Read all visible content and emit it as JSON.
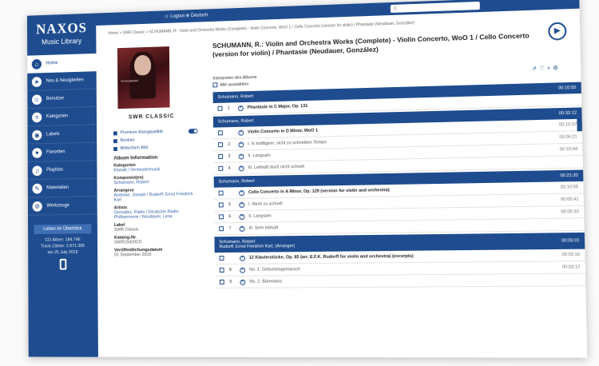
{
  "app": {
    "logo_title": "NAXOS",
    "logo_subtitle": "Music Library"
  },
  "topbar": {
    "links": "☺ Logout  ⊕ Deutsch",
    "search_placeholder": "Q"
  },
  "sidebar": {
    "items": [
      {
        "label": "Home",
        "icon": "home-icon",
        "glyph": "⌂",
        "active": true
      },
      {
        "label": "Neu & Neuigkeiten",
        "icon": "new-icon",
        "glyph": "★",
        "active": false
      },
      {
        "label": "Benutzer",
        "icon": "user-icon",
        "glyph": "☺",
        "active": false
      },
      {
        "label": "Kategorien",
        "icon": "categories-icon",
        "glyph": "≡",
        "active": false
      },
      {
        "label": "Labels",
        "icon": "labels-icon",
        "glyph": "◉",
        "active": false
      },
      {
        "label": "Favoriten",
        "icon": "favorites-icon",
        "glyph": "♥",
        "active": false
      },
      {
        "label": "Playlists",
        "icon": "playlist-icon",
        "glyph": "♫",
        "active": false
      },
      {
        "label": "Materialien",
        "icon": "materials-icon",
        "glyph": "✎",
        "active": false
      },
      {
        "label": "Werkzeuge",
        "icon": "tools-icon",
        "glyph": "⚙",
        "active": false
      }
    ],
    "button": "Leben im Überblick",
    "info_lines": [
      "CD-Alben: 184.746",
      "Track-Zähler: 2.871.305",
      "am 25 July 2019"
    ]
  },
  "breadcrumb": "Home > SWR Classic > SCHUMANN, R.: Violin and Orchestra Works (Complete) - Violin Concerto, WoO 1 / Cello Concerto (version for violin) / Phantasie (Neudauer, González)",
  "album": {
    "title": "SCHUMANN, R.: Violin and Orchestra Works (Complete) - Violin Concerto, WoO 1 / Cello Concerto (version for violin) / Phantasie (Neudauer, González)",
    "cover_text": "SCHUMANN",
    "label_brand": "SWR CLASSIC",
    "options": [
      {
        "label": "Premium-Klangqualität",
        "toggle": true
      },
      {
        "label": "Booklet",
        "toggle": false
      },
      {
        "label": "Bildschirm Bild",
        "toggle": false
      }
    ],
    "info_heading": "Album Information",
    "fields": [
      {
        "label": "Kategorien",
        "value": "Klassik / Orchestermusik",
        "link": true
      },
      {
        "label": "Komponist(en)",
        "value": "Schumann, Robert",
        "link": true
      },
      {
        "label": "Arrangeur",
        "value": "Andreae, Joseph / Rudorff, Ernst Friedrich Karl",
        "link": true
      },
      {
        "label": "Artists",
        "value": "González, Pablo / Deutsche Radio Philharmonie / Neudauer, Lena",
        "link": true
      },
      {
        "label": "Label",
        "value": "SWR Classic",
        "link": false
      },
      {
        "label": "Katalog-Nr.",
        "value": "SWR19420CD",
        "link": false
      },
      {
        "label": "Veröffentlichungsdatum",
        "value": "01 September 2016",
        "link": false
      }
    ],
    "interpret_label": "Interpreten des Albums",
    "select_all": "Alle auswählen"
  },
  "tracks": [
    {
      "type": "header",
      "text": "Schumann, Robert",
      "duration": "00:10:55"
    },
    {
      "type": "work",
      "num": "1",
      "text": "Phantasie in C Major, Op. 131",
      "duration": ""
    },
    {
      "type": "header",
      "text": "Schumann, Robert",
      "duration": "00:32:12"
    },
    {
      "type": "work",
      "num": "",
      "text": "Violin Concerto in D Minor, WoO 1",
      "duration": "00:15:07"
    },
    {
      "type": "move",
      "num": "2",
      "text": "I. In kräftigem, nicht zu schnellem Tempo",
      "duration": "00:06:21"
    },
    {
      "type": "move",
      "num": "3",
      "text": "II. Langsam",
      "duration": "00:10:04"
    },
    {
      "type": "move",
      "num": "4",
      "text": "III. Lebhaft doch nicht schnell",
      "duration": ""
    },
    {
      "type": "header",
      "text": "Schumann, Robert",
      "duration": "00:21:20"
    },
    {
      "type": "work",
      "num": "",
      "text": "Cello Concerto in A Minor, Op. 129 (version for violin and orchestra)",
      "duration": "00:10:55"
    },
    {
      "type": "move",
      "num": "5",
      "text": "I. Nicht zu schnell",
      "duration": "00:05:41"
    },
    {
      "type": "move",
      "num": "6",
      "text": "II. Langsam",
      "duration": "00:05:33"
    },
    {
      "type": "move",
      "num": "7",
      "text": "III. Sehr lebhaft",
      "duration": ""
    },
    {
      "type": "header2",
      "text": "Schumann, Robert",
      "text2": "Rudorff, Ernst Friedrich Karl, (Arranger)",
      "duration": "00:06:01"
    },
    {
      "type": "work",
      "num": "",
      "text": "12 Klavierstücke, Op. 85 (arr. E.F.K. Rudorff for violin and orchestra) (excerpts)",
      "duration": "00:03:16"
    },
    {
      "type": "move",
      "num": "8",
      "text": "No. 1. Geburtstagsmarsch",
      "duration": "00:03:12"
    },
    {
      "type": "move",
      "num": "9",
      "text": "No. 2. Bärentanz",
      "duration": ""
    }
  ]
}
